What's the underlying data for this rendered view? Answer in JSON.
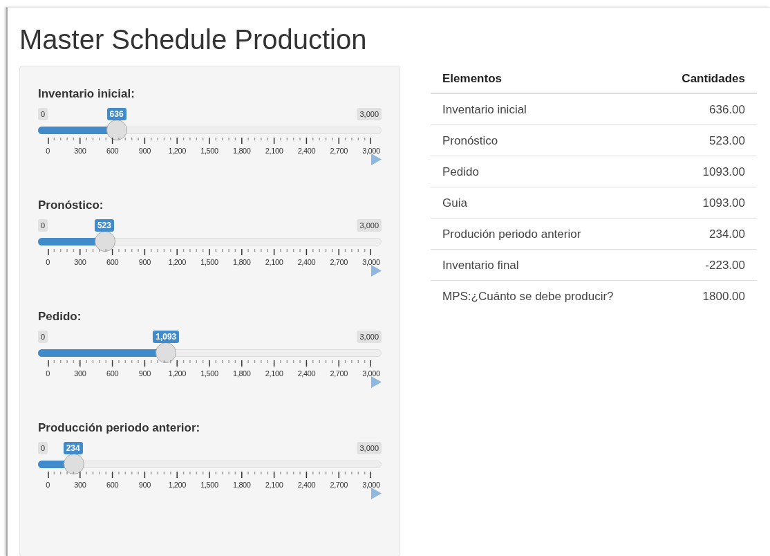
{
  "title": "Master Schedule Production",
  "sliders": [
    {
      "label": "Inventario inicial:",
      "min": "0",
      "max": "3,000",
      "value": "636",
      "level": 0.212,
      "ticks": [
        "0",
        "300",
        "600",
        "900",
        "1,200",
        "1,500",
        "1,800",
        "2,100",
        "2,400",
        "2,700",
        "3,000"
      ]
    },
    {
      "label": "Pronóstico:",
      "min": "0",
      "max": "3,000",
      "value": "523",
      "level": 0.1743,
      "ticks": [
        "0",
        "300",
        "600",
        "900",
        "1,200",
        "1,500",
        "1,800",
        "2,100",
        "2,400",
        "2,700",
        "3,000"
      ]
    },
    {
      "label": "Pedido:",
      "min": "0",
      "max": "3,000",
      "value": "1,093",
      "level": 0.3643,
      "ticks": [
        "0",
        "300",
        "600",
        "900",
        "1,200",
        "1,500",
        "1,800",
        "2,100",
        "2,400",
        "2,700",
        "3,000"
      ]
    },
    {
      "label": "Producción periodo anterior:",
      "min": "0",
      "max": "3,000",
      "value": "234",
      "level": 0.078,
      "ticks": [
        "0",
        "300",
        "600",
        "900",
        "1,200",
        "1,500",
        "1,800",
        "2,100",
        "2,400",
        "2,700",
        "3,000"
      ]
    }
  ],
  "table": {
    "columns": [
      "Elementos",
      "Cantidades"
    ],
    "rows": [
      [
        "Inventario inicial",
        "636.00"
      ],
      [
        "Pronóstico",
        "523.00"
      ],
      [
        "Pedido",
        "1093.00"
      ],
      [
        "Guia",
        "1093.00"
      ],
      [
        "Produción periodo anterior",
        "234.00"
      ],
      [
        "Inventario final",
        "-223.00"
      ],
      [
        "MPS:¿Cuánto se debe producir?",
        "1800.00"
      ]
    ]
  }
}
